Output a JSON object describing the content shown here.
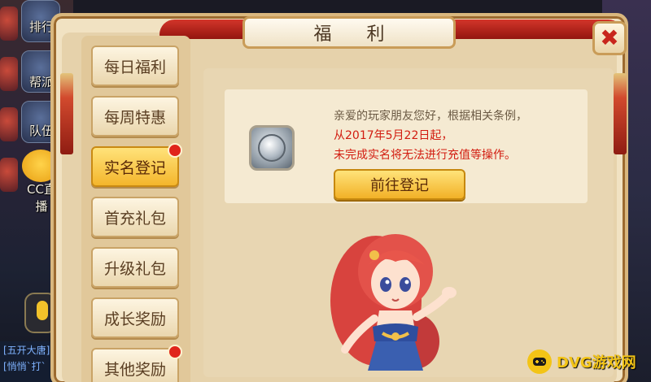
{
  "dialog": {
    "title": "福 利",
    "close_symbol": "✖"
  },
  "tabs": [
    {
      "label": "每日福利",
      "active": false,
      "badge": false
    },
    {
      "label": "每周特惠",
      "active": false,
      "badge": false
    },
    {
      "label": "实名登记",
      "active": true,
      "badge": true
    },
    {
      "label": "首充礼包",
      "active": false,
      "badge": false
    },
    {
      "label": "升级礼包",
      "active": false,
      "badge": false
    },
    {
      "label": "成长奖励",
      "active": false,
      "badge": false
    },
    {
      "label": "其他奖励",
      "active": false,
      "badge": true
    }
  ],
  "notice": {
    "line1": "亲爱的玩家朋友您好，根据相关条例，",
    "line2": "从2017年5月22日起，",
    "line3": "未完成实名将无法进行充值等操作。",
    "button_label": "前往登记",
    "icon": "silver-coin-icon"
  },
  "background": {
    "side_labels": [
      "排行",
      "帮派",
      "队伍",
      "CC直播"
    ],
    "chat_lines": [
      "[五开大唐]",
      "[悄悄`打`"
    ]
  },
  "watermark": {
    "text": "DVG游戏网"
  },
  "colors": {
    "frame": "#d9b77e",
    "accent_red": "#d21c10",
    "active_tab": "#f4b62c",
    "badge": "#e0241b"
  }
}
